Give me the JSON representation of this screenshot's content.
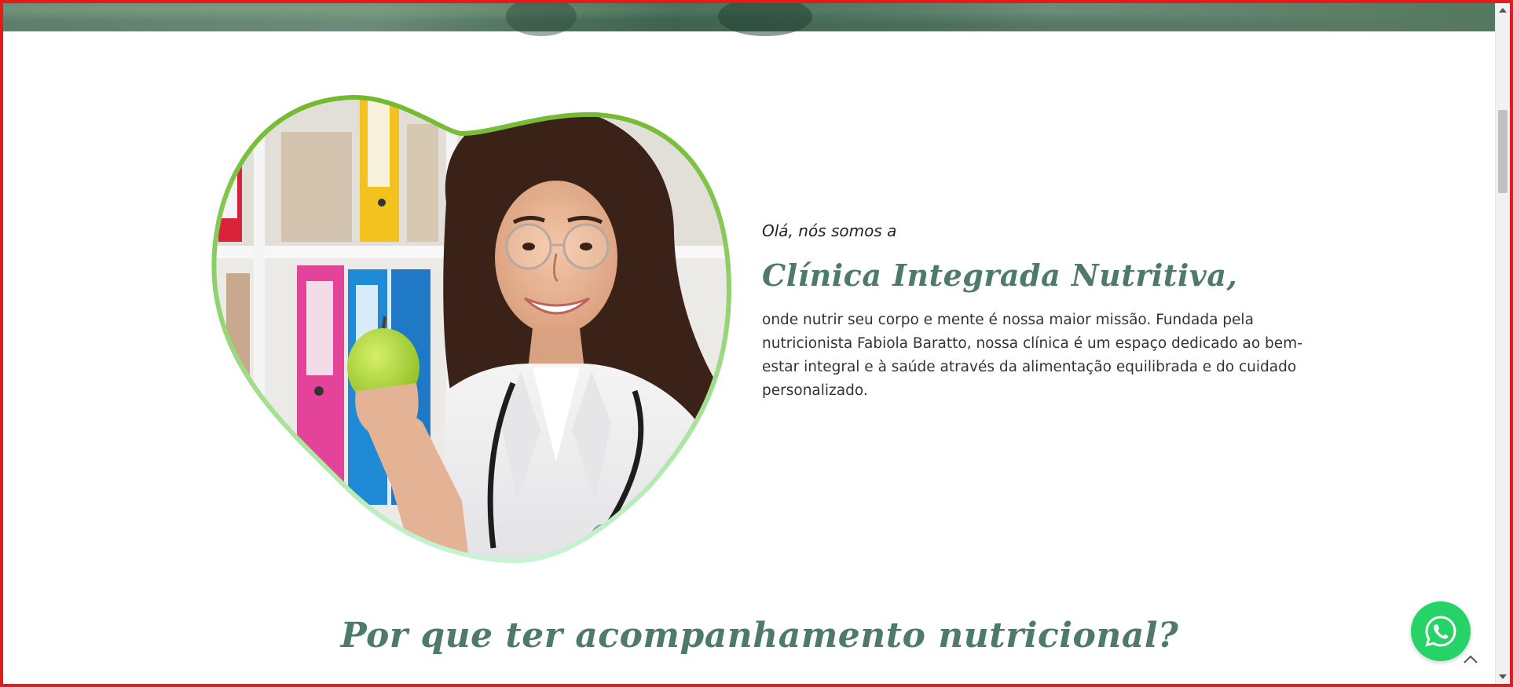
{
  "hero": {
    "image_name": "hero-background-image"
  },
  "about": {
    "photo_name": "nutritionist-photo",
    "pre_title": "Olá, nós somos a",
    "title": "Clínica Integrada Nutritiva,",
    "body": "onde nutrir seu corpo e mente é nossa maior missão. Fundada pela nutricionista Fabiola Baratto, nossa clínica é um espaço dedicado ao bem-estar integral e à saúde através da alimentação equilibrada e do cuidado personalizado."
  },
  "section": {
    "title": "Por que ter acompanhamento nutricional?"
  },
  "floating": {
    "whatsapp_icon": "whatsapp-icon",
    "back_to_top_icon": "chevron-up-icon"
  },
  "colors": {
    "brand_green": "#4d7a6a",
    "blob_border_top": "#7cc13a",
    "blob_border_bottom": "#b9f0c8",
    "whatsapp": "#25d366",
    "viewport_border": "#e31b1b"
  }
}
